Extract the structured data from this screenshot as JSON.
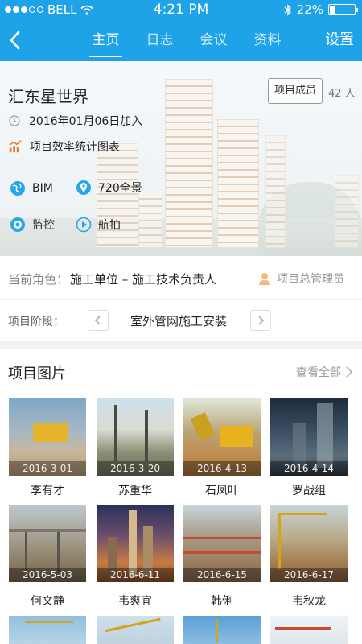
{
  "status": {
    "carrier": "BELL",
    "time": "4:21 PM",
    "battery": "22%",
    "battery_level": 0.22
  },
  "nav": {
    "tabs": [
      {
        "label": "主页",
        "active": true
      },
      {
        "label": "日志",
        "active": false
      },
      {
        "label": "会议",
        "active": false
      },
      {
        "label": "资料",
        "active": false
      }
    ],
    "settings": "设置"
  },
  "project": {
    "name": "汇东星世界",
    "members_button": "项目成员",
    "member_count": "42 人",
    "joined": "2016年01月06日加入",
    "stats_link": "项目效率统计图表",
    "features": [
      "BIM",
      "720全景",
      "监控",
      "航拍"
    ]
  },
  "role": {
    "label": "当前角色：",
    "value": "施工单位 – 施工技术负责人",
    "admin": "项目总管理员"
  },
  "stage": {
    "label": "项目阶段：",
    "value": "室外管网施工安装"
  },
  "photos": {
    "title": "项目图片",
    "view_all": "查看全部",
    "items": [
      {
        "date": "2016-3-01",
        "name": "李有才"
      },
      {
        "date": "2016-3-20",
        "name": "苏重华"
      },
      {
        "date": "2016-4-13",
        "name": "石凤叶"
      },
      {
        "date": "2016-4-14",
        "name": "罗战组"
      },
      {
        "date": "2016-5-03",
        "name": "何文静"
      },
      {
        "date": "2016-6-11",
        "name": "韦爽宜"
      },
      {
        "date": "2016-6-15",
        "name": "韩俐"
      },
      {
        "date": "2016-6-17",
        "name": "韦秋龙"
      }
    ]
  },
  "colors": {
    "brand": "#1fa3e8",
    "icon_blue": "#29a6e6",
    "icon_orange": "#f07a2a"
  }
}
